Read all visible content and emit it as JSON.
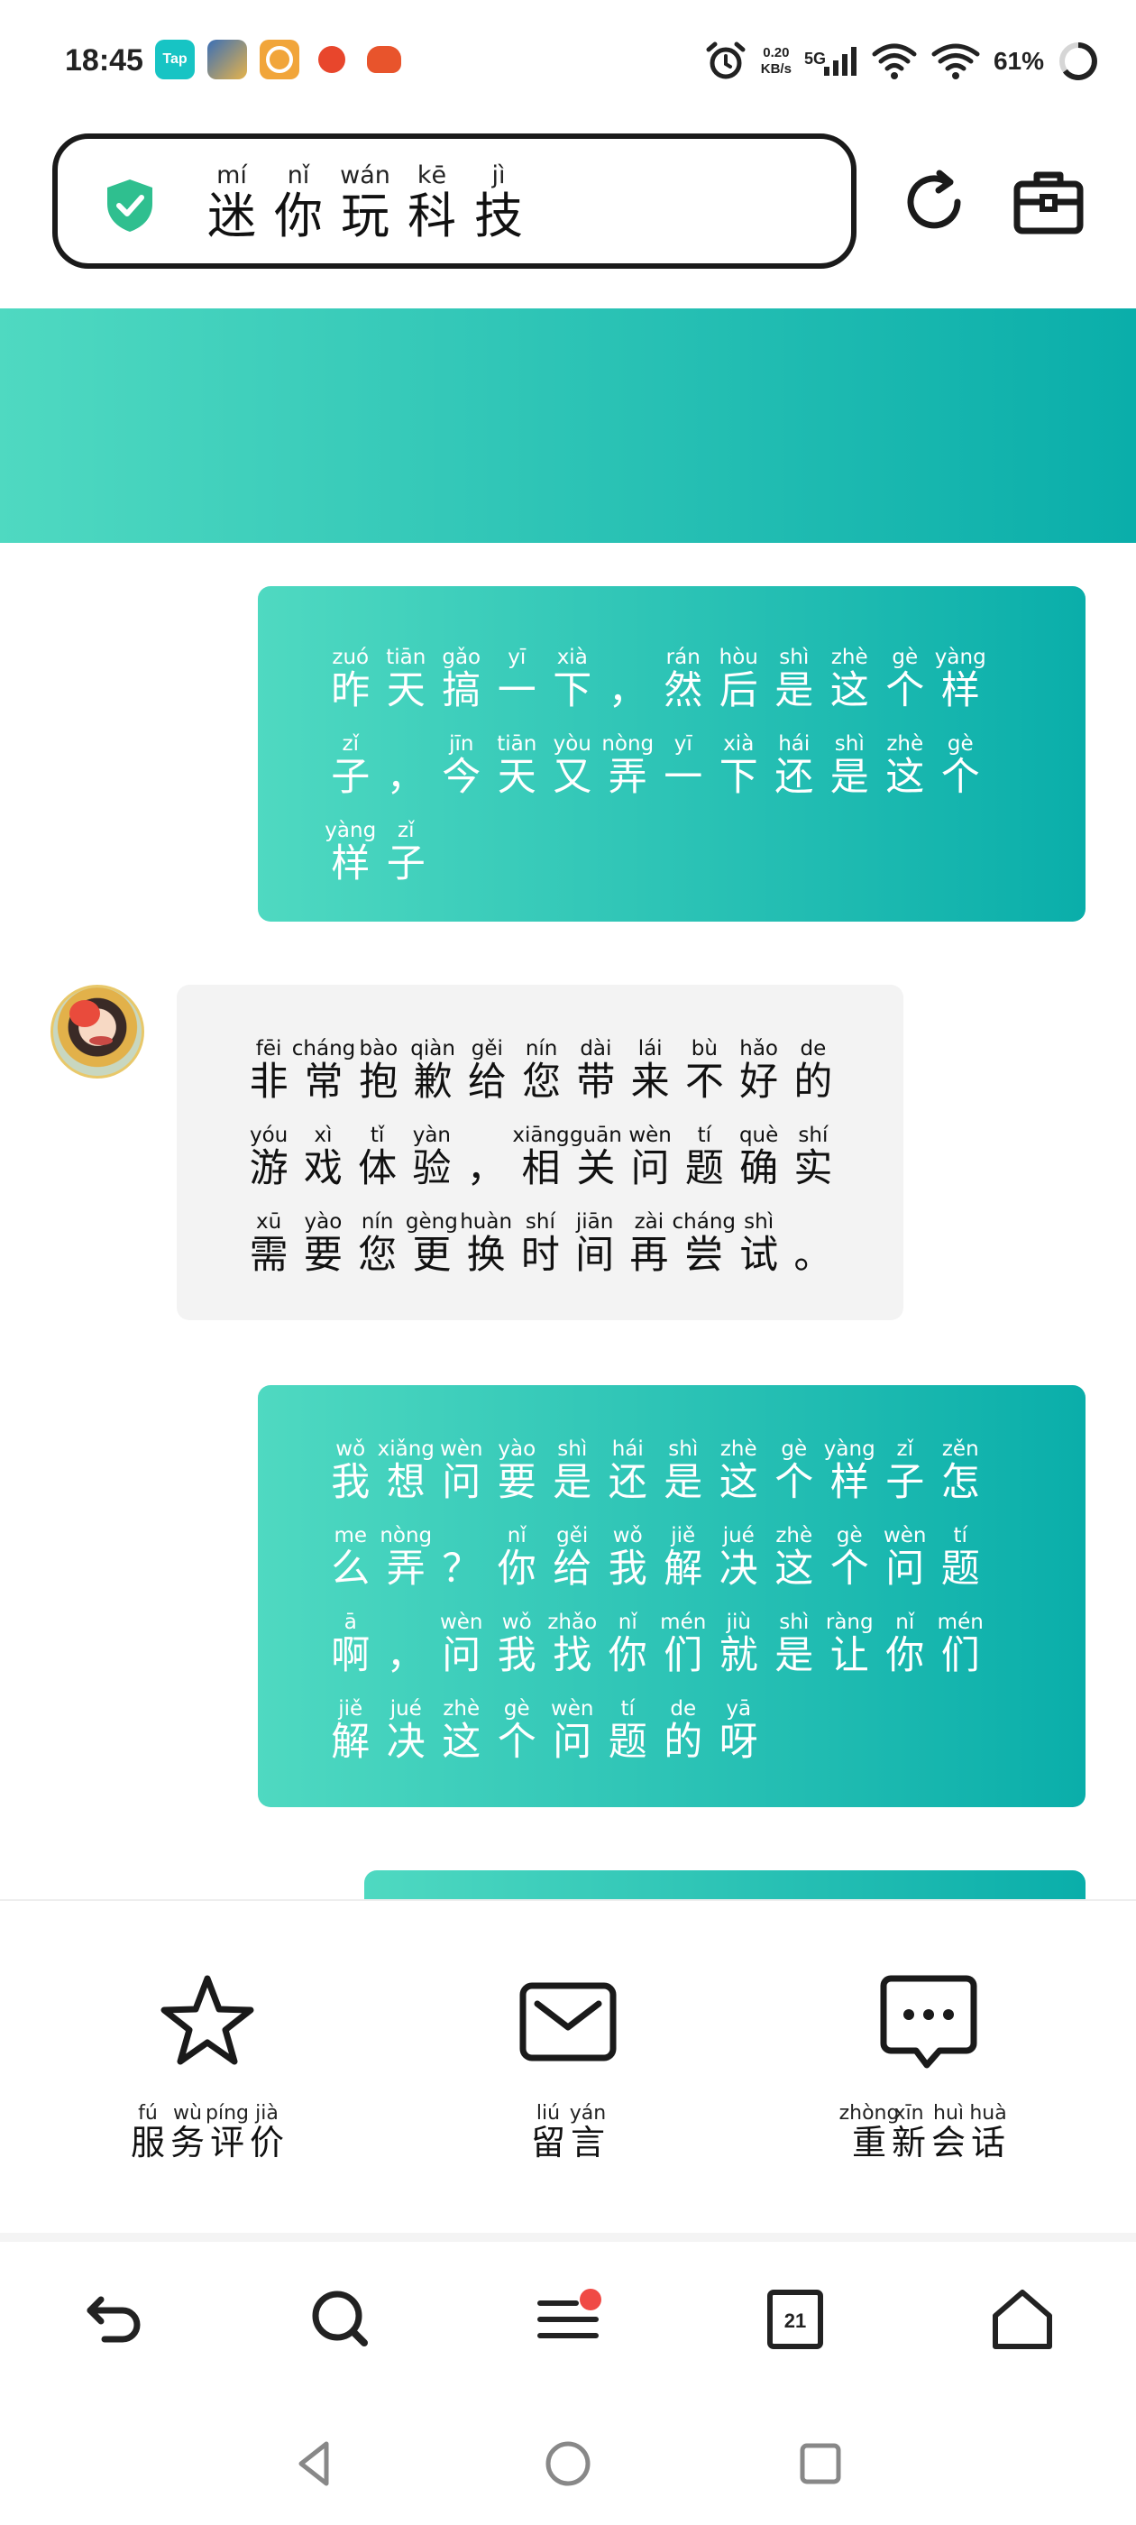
{
  "status_bar": {
    "time": "18:45",
    "notifications": [
      "tap-app-icon",
      "game-app-icon",
      "target-app-icon",
      "red-app-icon",
      "pumpkin-app-icon"
    ],
    "network_speed_value": "0.20",
    "network_speed_unit": "KB/s",
    "signal_label": "5G",
    "battery_percent": "61%"
  },
  "address_bar": {
    "title_chars": [
      {
        "py": "mí",
        "hz": "迷"
      },
      {
        "py": "nǐ",
        "hz": "你"
      },
      {
        "py": "wán",
        "hz": "玩"
      },
      {
        "py": "kē",
        "hz": "科"
      },
      {
        "py": "jì",
        "hz": "技"
      }
    ],
    "icons": {
      "secure": "shield-check-icon",
      "reload": "reload-icon",
      "toolbox": "toolbox-icon"
    }
  },
  "colors": {
    "accent_start": "#4fd9c1",
    "accent_end": "#0aaeaa",
    "shield": "#2fbf8f",
    "badge": "#f04a45"
  },
  "messages": [
    {
      "role": "user",
      "lines": [
        [
          {
            "py": "zuó",
            "hz": "昨"
          },
          {
            "py": "tiān",
            "hz": "天"
          },
          {
            "py": "gǎo",
            "hz": "搞"
          },
          {
            "py": "yī",
            "hz": "一"
          },
          {
            "py": "xià",
            "hz": "下"
          },
          {
            "py": "",
            "hz": "，"
          },
          {
            "py": "rán",
            "hz": "然"
          },
          {
            "py": "hòu",
            "hz": "后"
          },
          {
            "py": "shì",
            "hz": "是"
          },
          {
            "py": "zhè",
            "hz": "这"
          },
          {
            "py": "gè",
            "hz": "个"
          },
          {
            "py": "yàng",
            "hz": "样"
          }
        ],
        [
          {
            "py": "zǐ",
            "hz": "子"
          },
          {
            "py": "",
            "hz": "，"
          },
          {
            "py": "jīn",
            "hz": "今"
          },
          {
            "py": "tiān",
            "hz": "天"
          },
          {
            "py": "yòu",
            "hz": "又"
          },
          {
            "py": "nòng",
            "hz": "弄"
          },
          {
            "py": "yī",
            "hz": "一"
          },
          {
            "py": "xià",
            "hz": "下"
          },
          {
            "py": "hái",
            "hz": "还"
          },
          {
            "py": "shì",
            "hz": "是"
          },
          {
            "py": "zhè",
            "hz": "这"
          },
          {
            "py": "gè",
            "hz": "个"
          }
        ],
        [
          {
            "py": "yàng",
            "hz": "样"
          },
          {
            "py": "zǐ",
            "hz": "子"
          }
        ]
      ]
    },
    {
      "role": "bot",
      "lines": [
        [
          {
            "py": "fēi",
            "hz": "非"
          },
          {
            "py": "cháng",
            "hz": "常"
          },
          {
            "py": "bào",
            "hz": "抱"
          },
          {
            "py": "qiàn",
            "hz": "歉"
          },
          {
            "py": "gěi",
            "hz": "给"
          },
          {
            "py": "nín",
            "hz": "您"
          },
          {
            "py": "dài",
            "hz": "带"
          },
          {
            "py": "lái",
            "hz": "来"
          },
          {
            "py": "bù",
            "hz": "不"
          },
          {
            "py": "hǎo",
            "hz": "好"
          },
          {
            "py": "de",
            "hz": "的"
          }
        ],
        [
          {
            "py": "yóu",
            "hz": "游"
          },
          {
            "py": "xì",
            "hz": "戏"
          },
          {
            "py": "tǐ",
            "hz": "体"
          },
          {
            "py": "yàn",
            "hz": "验"
          },
          {
            "py": "",
            "hz": "，"
          },
          {
            "py": "xiāng",
            "hz": "相"
          },
          {
            "py": "guān",
            "hz": "关"
          },
          {
            "py": "wèn",
            "hz": "问"
          },
          {
            "py": "tí",
            "hz": "题"
          },
          {
            "py": "què",
            "hz": "确"
          },
          {
            "py": "shí",
            "hz": "实"
          }
        ],
        [
          {
            "py": "xū",
            "hz": "需"
          },
          {
            "py": "yào",
            "hz": "要"
          },
          {
            "py": "nín",
            "hz": "您"
          },
          {
            "py": "gèng",
            "hz": "更"
          },
          {
            "py": "huàn",
            "hz": "换"
          },
          {
            "py": "shí",
            "hz": "时"
          },
          {
            "py": "jiān",
            "hz": "间"
          },
          {
            "py": "zài",
            "hz": "再"
          },
          {
            "py": "cháng",
            "hz": "尝"
          },
          {
            "py": "shì",
            "hz": "试"
          },
          {
            "py": "",
            "hz": "。"
          }
        ]
      ]
    },
    {
      "role": "user",
      "lines": [
        [
          {
            "py": "wǒ",
            "hz": "我"
          },
          {
            "py": "xiǎng",
            "hz": "想"
          },
          {
            "py": "wèn",
            "hz": "问"
          },
          {
            "py": "yào",
            "hz": "要"
          },
          {
            "py": "shì",
            "hz": "是"
          },
          {
            "py": "hái",
            "hz": "还"
          },
          {
            "py": "shì",
            "hz": "是"
          },
          {
            "py": "zhè",
            "hz": "这"
          },
          {
            "py": "gè",
            "hz": "个"
          },
          {
            "py": "yàng",
            "hz": "样"
          },
          {
            "py": "zǐ",
            "hz": "子"
          },
          {
            "py": "zěn",
            "hz": "怎"
          }
        ],
        [
          {
            "py": "me",
            "hz": "么"
          },
          {
            "py": "nòng",
            "hz": "弄"
          },
          {
            "py": "",
            "hz": "？"
          },
          {
            "py": "nǐ",
            "hz": "你"
          },
          {
            "py": "gěi",
            "hz": "给"
          },
          {
            "py": "wǒ",
            "hz": "我"
          },
          {
            "py": "jiě",
            "hz": "解"
          },
          {
            "py": "jué",
            "hz": "决"
          },
          {
            "py": "zhè",
            "hz": "这"
          },
          {
            "py": "gè",
            "hz": "个"
          },
          {
            "py": "wèn",
            "hz": "问"
          },
          {
            "py": "tí",
            "hz": "题"
          }
        ],
        [
          {
            "py": "ā",
            "hz": "啊"
          },
          {
            "py": "",
            "hz": "，"
          },
          {
            "py": "wèn",
            "hz": "问"
          },
          {
            "py": "wǒ",
            "hz": "我"
          },
          {
            "py": "zhǎo",
            "hz": "找"
          },
          {
            "py": "nǐ",
            "hz": "你"
          },
          {
            "py": "mén",
            "hz": "们"
          },
          {
            "py": "jiù",
            "hz": "就"
          },
          {
            "py": "shì",
            "hz": "是"
          },
          {
            "py": "ràng",
            "hz": "让"
          },
          {
            "py": "nǐ",
            "hz": "你"
          },
          {
            "py": "mén",
            "hz": "们"
          }
        ],
        [
          {
            "py": "jiě",
            "hz": "解"
          },
          {
            "py": "jué",
            "hz": "决"
          },
          {
            "py": "zhè",
            "hz": "这"
          },
          {
            "py": "gè",
            "hz": "个"
          },
          {
            "py": "wèn",
            "hz": "问"
          },
          {
            "py": "tí",
            "hz": "题"
          },
          {
            "py": "de",
            "hz": "的"
          },
          {
            "py": "yā",
            "hz": "呀"
          }
        ]
      ]
    }
  ],
  "actions": [
    {
      "icon": "star-icon",
      "chars": [
        {
          "py": "fú",
          "hz": "服"
        },
        {
          "py": "wù",
          "hz": "务"
        },
        {
          "py": "píng",
          "hz": "评"
        },
        {
          "py": "jià",
          "hz": "价"
        }
      ]
    },
    {
      "icon": "envelope-icon",
      "chars": [
        {
          "py": "liú",
          "hz": "留"
        },
        {
          "py": "yán",
          "hz": "言"
        }
      ]
    },
    {
      "icon": "chat-bubble-icon",
      "chars": [
        {
          "py": "zhòng",
          "hz": "重"
        },
        {
          "py": "xīn",
          "hz": "新"
        },
        {
          "py": "huì",
          "hz": "会"
        },
        {
          "py": "huà",
          "hz": "话"
        }
      ]
    }
  ],
  "bottom_nav": {
    "icons": [
      "back-arrow-icon",
      "search-icon",
      "menu-icon",
      "tabs-icon",
      "home-icon"
    ],
    "tab_count": "21"
  },
  "system_nav": {
    "icons": [
      "back-triangle-icon",
      "home-circle-icon",
      "recents-square-icon"
    ]
  }
}
